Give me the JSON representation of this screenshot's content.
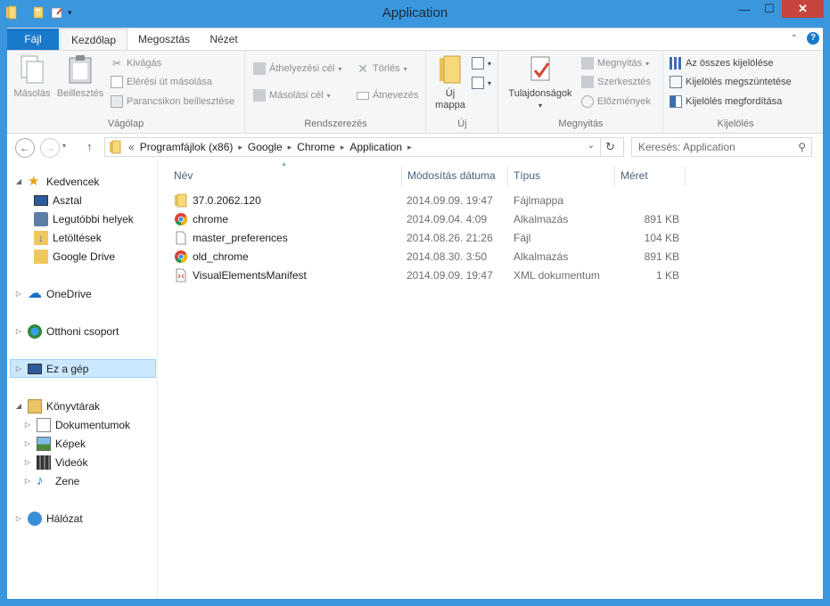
{
  "window": {
    "title": "Application",
    "minimize": "—",
    "maximize": "☐",
    "close": "✕"
  },
  "tabs": {
    "file": "Fájl",
    "home": "Kezdőlap",
    "share": "Megosztás",
    "view": "Nézet"
  },
  "ribbon": {
    "clipboard": {
      "label": "Vágólap",
      "copy": "Másolás",
      "paste": "Beillesztés",
      "cut": "Kivágás",
      "copy_path": "Elérési út másolása",
      "paste_shortcut": "Parancsikon beillesztése"
    },
    "organize": {
      "label": "Rendszerezés",
      "move_to": "Áthelyezési cél",
      "copy_to": "Másolási cél",
      "delete": "Törlés",
      "rename": "Átnevezés"
    },
    "new": {
      "label": "Új",
      "new_folder_1": "Új",
      "new_folder_2": "mappa"
    },
    "open": {
      "label": "Megnyitás",
      "properties": "Tulajdonságok",
      "open": "Megnyitás",
      "edit": "Szerkesztés",
      "history": "Előzmények"
    },
    "select": {
      "label": "Kijelölés",
      "select_all": "Az összes kijelölése",
      "select_none": "Kijelölés megszüntetése",
      "invert": "Kijelölés megfordítása"
    }
  },
  "address": {
    "prefix": "«",
    "segments": [
      "Programfájlok (x86)",
      "Google",
      "Chrome",
      "Application"
    ],
    "search_placeholder": "Keresés: Application"
  },
  "nav": {
    "favorites": "Kedvencek",
    "desktop": "Asztal",
    "recent": "Legutóbbi helyek",
    "downloads": "Letöltések",
    "google_drive": "Google Drive",
    "onedrive": "OneDrive",
    "homegroup": "Otthoni csoport",
    "this_pc": "Ez a gép",
    "libraries": "Könyvtárak",
    "documents": "Dokumentumok",
    "pictures": "Képek",
    "videos": "Videók",
    "music": "Zene",
    "network": "Hálózat"
  },
  "columns": {
    "name": "Név",
    "modified": "Módosítás dátuma",
    "type": "Típus",
    "size": "Méret"
  },
  "files": [
    {
      "name": "37.0.2062.120",
      "modified": "2014.09.09. 19:47",
      "type": "Fájlmappa",
      "size": "",
      "icon": "folder-icon"
    },
    {
      "name": "chrome",
      "modified": "2014.09.04. 4:09",
      "type": "Alkalmazás",
      "size": "891 KB",
      "icon": "chrome-icon"
    },
    {
      "name": "master_preferences",
      "modified": "2014.08.26. 21:26",
      "type": "Fájl",
      "size": "104 KB",
      "icon": "file-icon"
    },
    {
      "name": "old_chrome",
      "modified": "2014.08.30. 3:50",
      "type": "Alkalmazás",
      "size": "891 KB",
      "icon": "chrome-icon"
    },
    {
      "name": "VisualElementsManifest",
      "modified": "2014.09.09. 19:47",
      "type": "XML dokumentum",
      "size": "1 KB",
      "icon": "xml-file-icon"
    }
  ],
  "colors": {
    "frame": "#3a96dd",
    "file_tab": "#1979ca",
    "selection": "#cce8ff",
    "close": "#c7453c"
  }
}
